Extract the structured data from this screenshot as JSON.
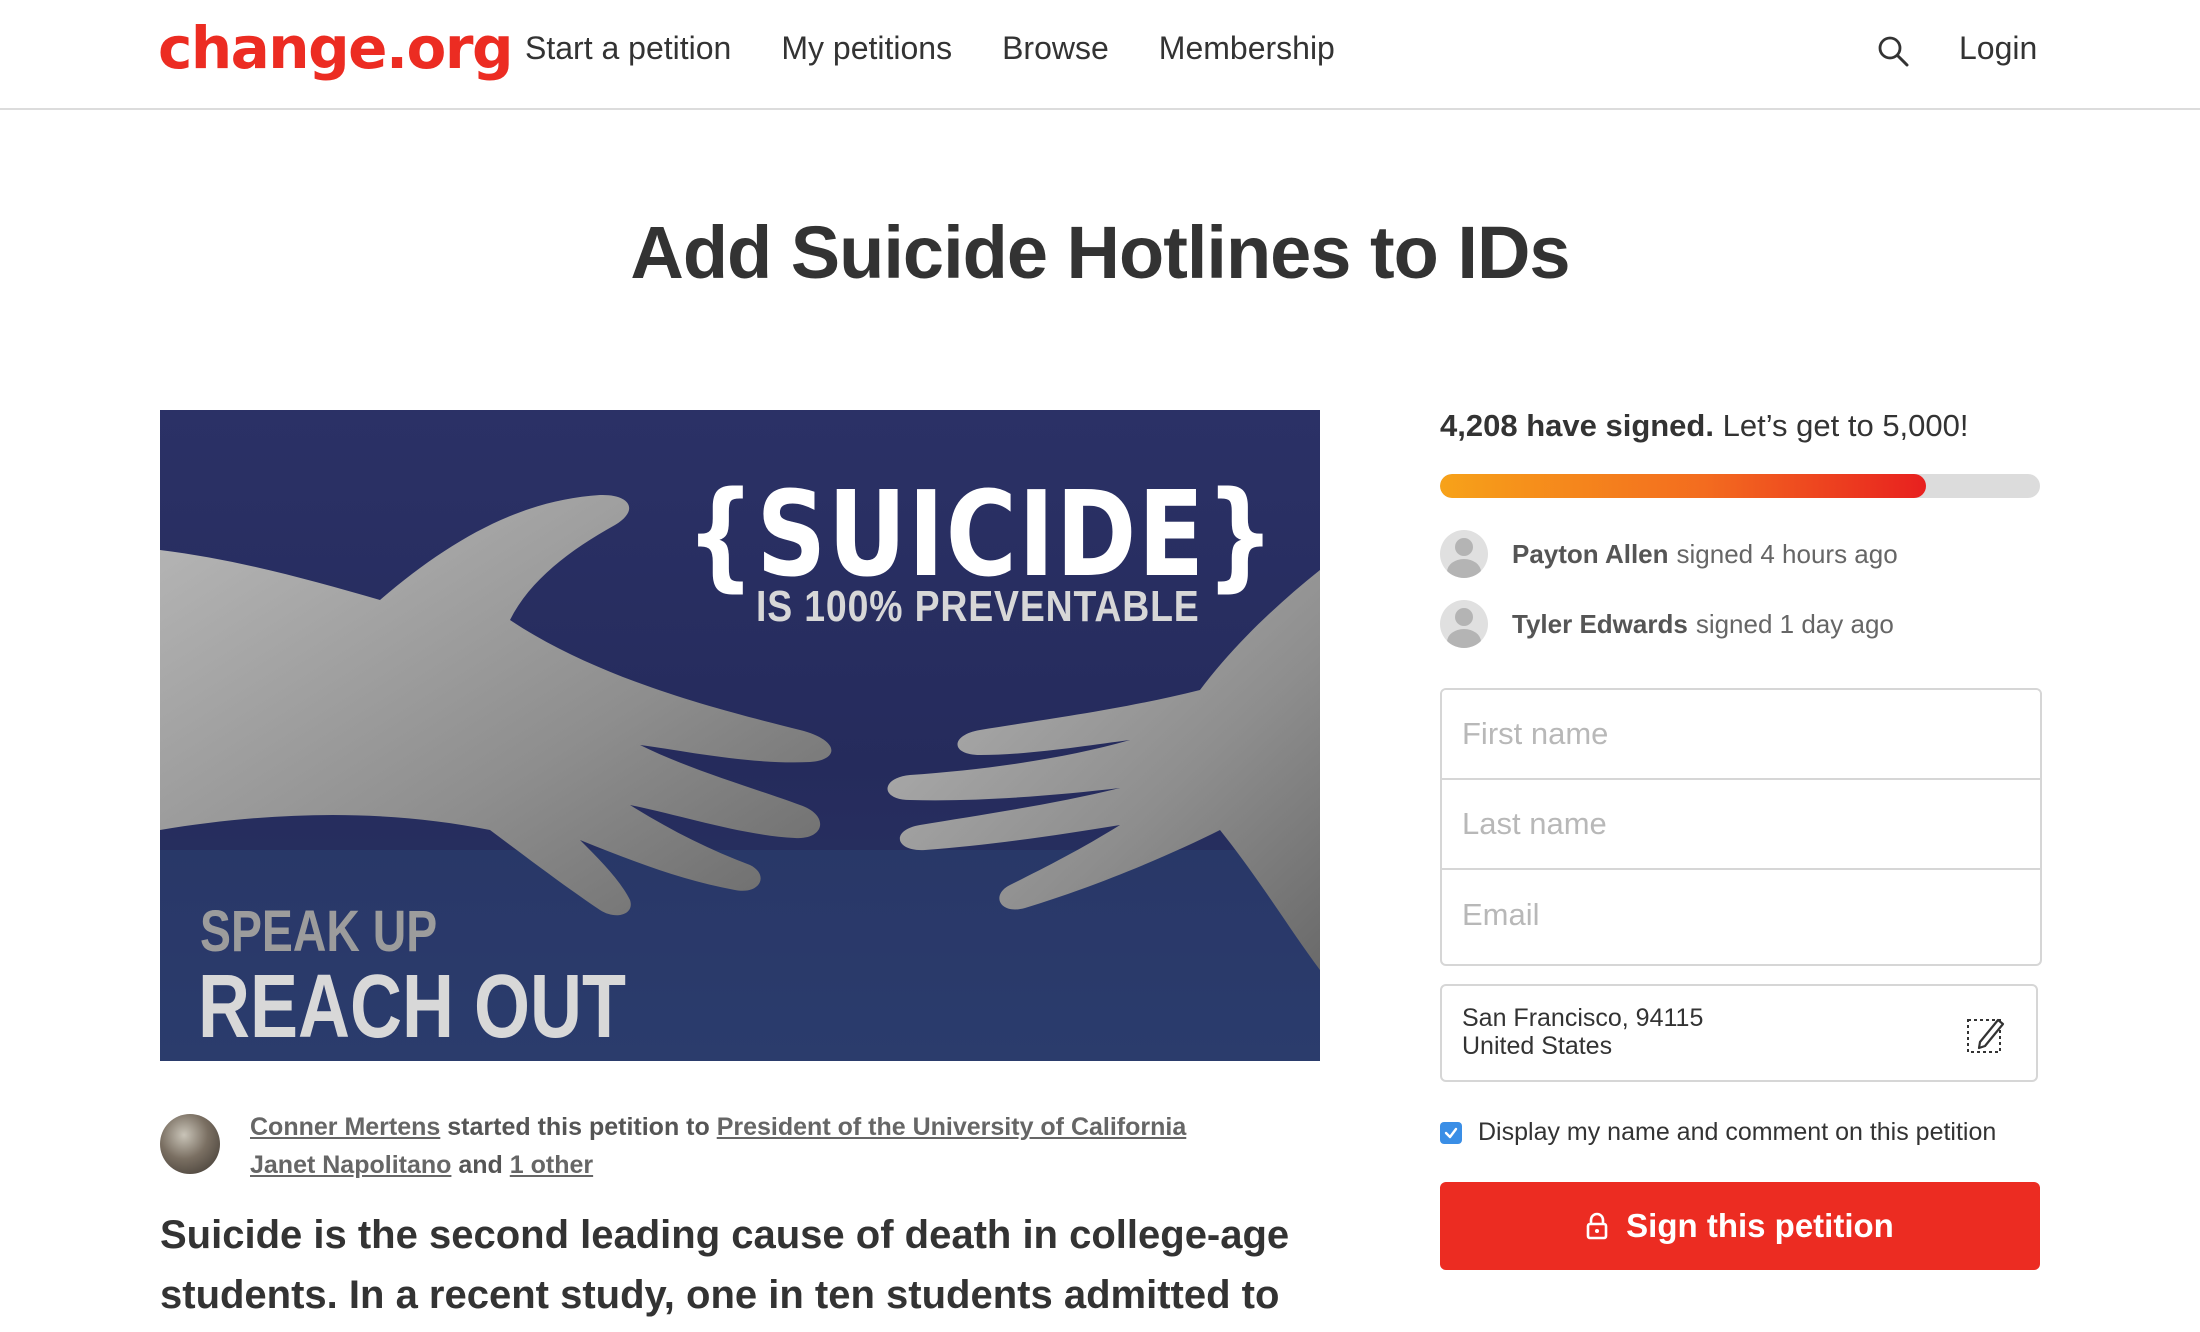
{
  "header": {
    "logo": "change.org",
    "nav": [
      "Start a petition",
      "My petitions",
      "Browse",
      "Membership"
    ],
    "login": "Login"
  },
  "petition": {
    "title": "Add Suicide Hotlines to IDs",
    "image_text": {
      "headline": "{SUICIDE}",
      "subline": "IS 100% PREVENTABLE",
      "speak": "SPEAK UP",
      "reach": "REACH OUT"
    },
    "starter": {
      "name": "Conner Mertens",
      "started_text": " started this petition to ",
      "target": "President of the University of California",
      "target2": "Janet Napolitano",
      "and_text": " and ",
      "other": "1 other"
    },
    "body": "Suicide is the second leading cause of death in college-age students. In a recent study, one in ten students admitted to"
  },
  "sign_box": {
    "signed_count": "4,208 have signed.",
    "goal_text": "Let’s get to 5,000!",
    "progress": 0.81,
    "recent_signers": [
      {
        "name": "Payton Allen",
        "time": "signed 4 hours ago"
      },
      {
        "name": "Tyler Edwards",
        "time": "signed 1 day ago"
      }
    ],
    "fields": {
      "first_name_placeholder": "First name",
      "last_name_placeholder": "Last name",
      "email_placeholder": "Email"
    },
    "location": {
      "line1": "San Francisco, 94115",
      "line2": "United States"
    },
    "display_option": "Display my name and comment on this petition",
    "display_checked": true,
    "button": "Sign this petition"
  },
  "colors": {
    "brand": "#ec2c22",
    "checkbox": "#3a8ee6",
    "progress_start": "#f7a219",
    "progress_end": "#e8201f"
  }
}
